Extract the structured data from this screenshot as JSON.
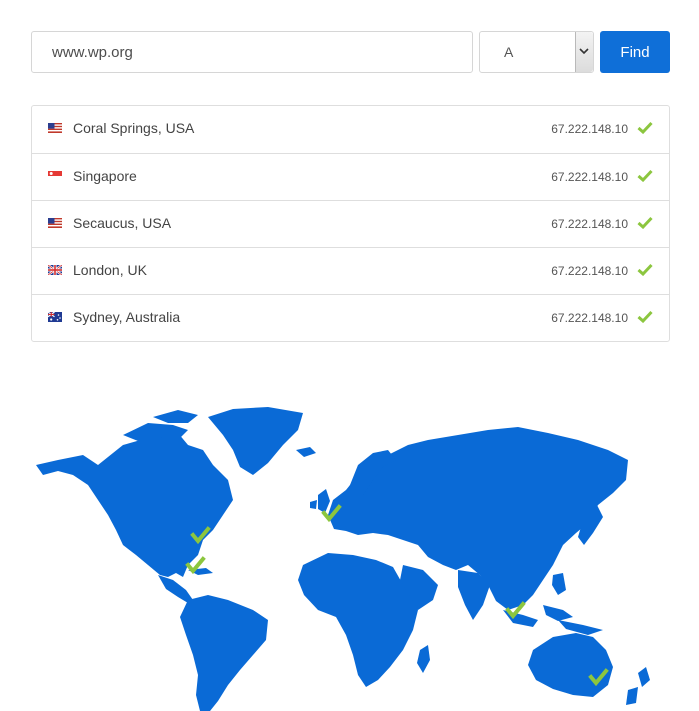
{
  "search": {
    "value": "www.wp.org"
  },
  "record_type": {
    "selected": "A"
  },
  "find_button": {
    "label": "Find"
  },
  "results": [
    {
      "flag": "us-flag-icon",
      "location": "Coral Springs, USA",
      "ip": "67.222.148.10",
      "status": "resolved"
    },
    {
      "flag": "singapore-flag-icon",
      "location": "Singapore",
      "ip": "67.222.148.10",
      "status": "resolved"
    },
    {
      "flag": "us-flag-icon",
      "location": "Secaucus, USA",
      "ip": "67.222.148.10",
      "status": "resolved"
    },
    {
      "flag": "uk-flag-icon",
      "location": "London, UK",
      "ip": "67.222.148.10",
      "status": "resolved"
    },
    {
      "flag": "australia-flag-icon",
      "location": "Sydney, Australia",
      "ip": "67.222.148.10",
      "status": "resolved"
    }
  ],
  "colors": {
    "accent": "#0f6fd8",
    "map_fill": "#0a6ad6",
    "check": "#8cc63f"
  }
}
